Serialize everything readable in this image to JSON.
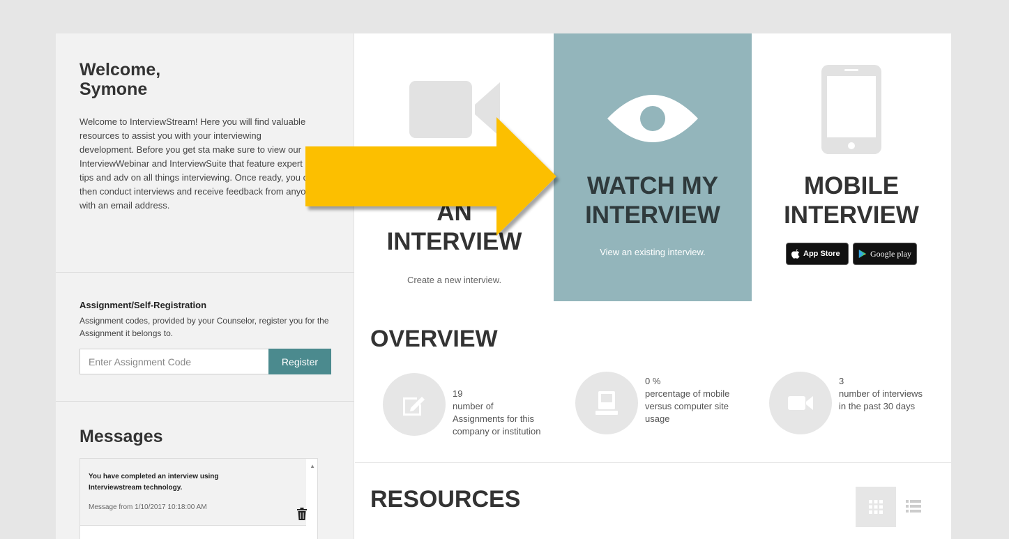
{
  "sidebar": {
    "welcome_title": "Welcome, Symone",
    "welcome_text": "Welcome to InterviewStream! Here you will find valuable resources to assist you with your interviewing development. Before you get sta make sure to view our InterviewWebinar and InterviewSuite that feature expert tips and adv on all things interviewing. Once ready, you ca then conduct interviews and receive feedback from anyone with an email address.",
    "assignment": {
      "title": "Assignment/Self-Registration",
      "description": "Assignment codes, provided by your Counselor, register you for the Assignment it belongs to.",
      "placeholder": "Enter Assignment Code",
      "register_label": "Register"
    },
    "messages": {
      "title": "Messages",
      "items": [
        {
          "text": "You have completed an interview using Interviewstream technology.",
          "date": "Message from 1/10/2017 10:18:00 AM"
        }
      ]
    }
  },
  "tiles": {
    "create": {
      "title_line1": "AN",
      "title_line2": "INTERVIEW",
      "subtitle": "Create a new interview."
    },
    "watch": {
      "title_line1": "WATCH MY",
      "title_line2": "INTERVIEW",
      "subtitle": "View an existing interview."
    },
    "mobile": {
      "title_line1": "MOBILE",
      "title_line2": "INTERVIEW",
      "app_store_label": "App Store",
      "google_play_label": "Google play"
    }
  },
  "overview": {
    "title": "OVERVIEW",
    "stats": [
      {
        "value": "19",
        "label": "number of Assignments for this company or institution",
        "icon": "edit-icon"
      },
      {
        "value": "0 %",
        "label": "percentage of mobile versus computer site usage",
        "icon": "computer-icon"
      },
      {
        "value": "3",
        "label": "number of interviews in the past 30 days",
        "icon": "video-camera-icon"
      }
    ]
  },
  "resources": {
    "title": "RESOURCES"
  },
  "colors": {
    "accent_teal": "#4b8a8e",
    "watch_tile_bg": "#93b5bb",
    "arrow_yellow": "#fcbf00",
    "page_bg": "#e6e6e6",
    "sidebar_bg": "#f2f2f2"
  }
}
